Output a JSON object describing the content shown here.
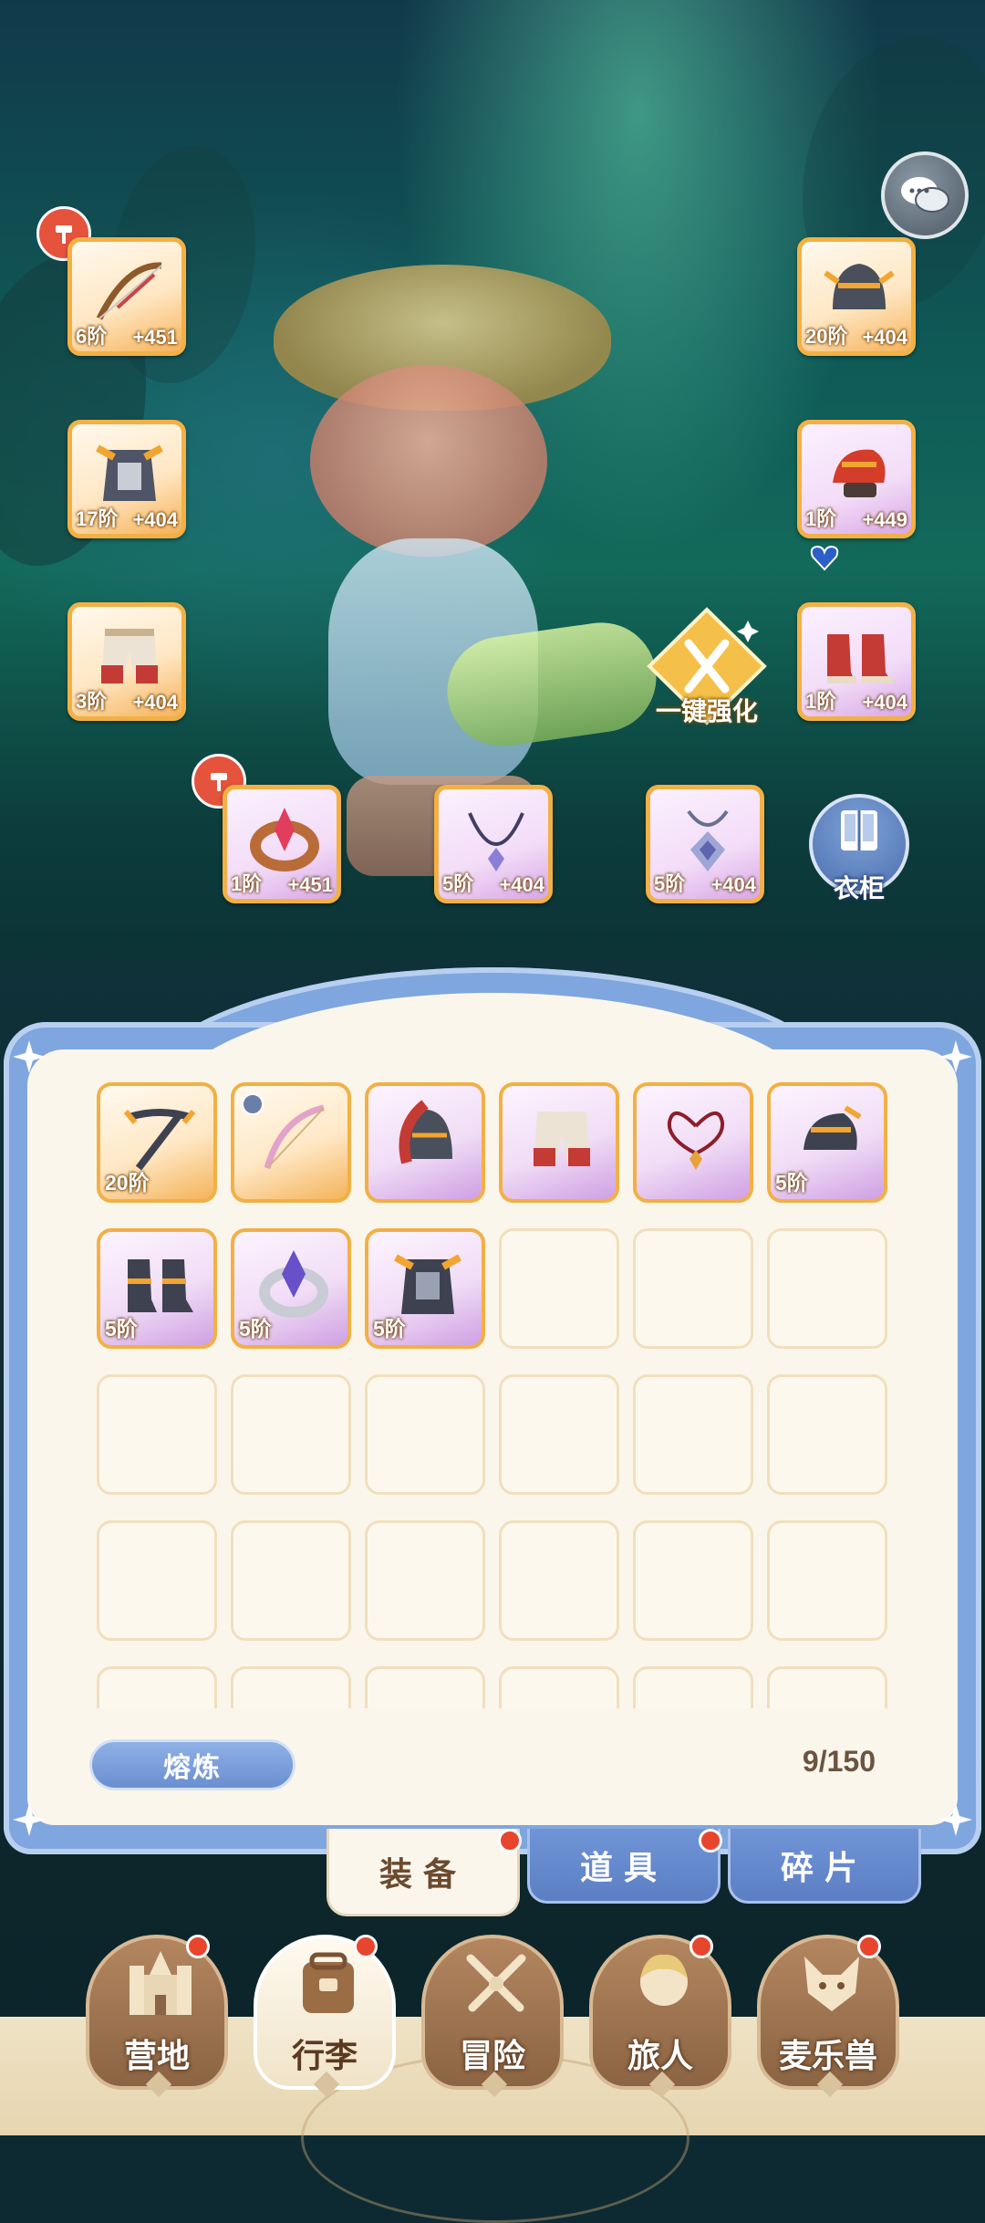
{
  "equipped": {
    "weapon": {
      "tier": "6阶",
      "bonus": "+451",
      "rarity": "orange",
      "icon": "bow-icon",
      "upgradable": true
    },
    "helmet": {
      "tier": "20阶",
      "bonus": "+404",
      "rarity": "orange",
      "icon": "helmet-icon"
    },
    "armor": {
      "tier": "17阶",
      "bonus": "+404",
      "rarity": "orange",
      "icon": "armor-icon"
    },
    "gloves": {
      "tier": "1阶",
      "bonus": "+449",
      "rarity": "purple",
      "icon": "gauntlet-icon"
    },
    "pants": {
      "tier": "3阶",
      "bonus": "+404",
      "rarity": "orange",
      "icon": "pants-icon"
    },
    "boots": {
      "tier": "1阶",
      "bonus": "+404",
      "rarity": "purple",
      "icon": "boots-icon"
    },
    "ring": {
      "tier": "1阶",
      "bonus": "+451",
      "rarity": "purple",
      "icon": "ring-icon",
      "upgradable": true
    },
    "necklace": {
      "tier": "5阶",
      "bonus": "+404",
      "rarity": "purple",
      "icon": "necklace-icon"
    },
    "amulet": {
      "tier": "5阶",
      "bonus": "+404",
      "rarity": "purple",
      "icon": "amulet-icon"
    }
  },
  "actions": {
    "one_key_enhance": "一键强化",
    "wardrobe": "衣柜",
    "smelt": "熔炼"
  },
  "inventory": {
    "count": "9/150",
    "items": [
      {
        "tier": "20阶",
        "rarity": "orange",
        "icon": "crossbow-icon"
      },
      {
        "tier": "",
        "rarity": "orange",
        "icon": "bow-icon",
        "locked": true
      },
      {
        "tier": "",
        "rarity": "purple",
        "icon": "helmet-icon"
      },
      {
        "tier": "",
        "rarity": "purple",
        "icon": "pants-icon"
      },
      {
        "tier": "",
        "rarity": "purple",
        "icon": "necklace-icon"
      },
      {
        "tier": "5阶",
        "rarity": "purple",
        "icon": "gauntlet-icon"
      },
      {
        "tier": "5阶",
        "rarity": "purple",
        "icon": "boots-icon"
      },
      {
        "tier": "5阶",
        "rarity": "purple",
        "icon": "ring-icon"
      },
      {
        "tier": "5阶",
        "rarity": "purple",
        "icon": "armor-icon"
      }
    ]
  },
  "tabs": [
    {
      "label": "装备",
      "active": true,
      "badge": true
    },
    {
      "label": "道具",
      "active": false,
      "badge": true
    },
    {
      "label": "碎片",
      "active": false,
      "badge": false
    }
  ],
  "nav": [
    {
      "label": "营地",
      "icon": "castle-icon",
      "active": false,
      "badge": true
    },
    {
      "label": "行李",
      "icon": "backpack-icon",
      "active": true,
      "badge": true
    },
    {
      "label": "冒险",
      "icon": "crossed-swords-icon",
      "active": false,
      "badge": false
    },
    {
      "label": "旅人",
      "icon": "traveler-avatar-icon",
      "active": false,
      "badge": true
    },
    {
      "label": "麦乐兽",
      "icon": "fox-pet-icon",
      "active": false,
      "badge": true
    }
  ],
  "colors": {
    "orange_border": "#f2b045",
    "purple_fill": "#d7a7e6",
    "panel_blue": "#7fa6de",
    "badge_red": "#e8452e"
  }
}
